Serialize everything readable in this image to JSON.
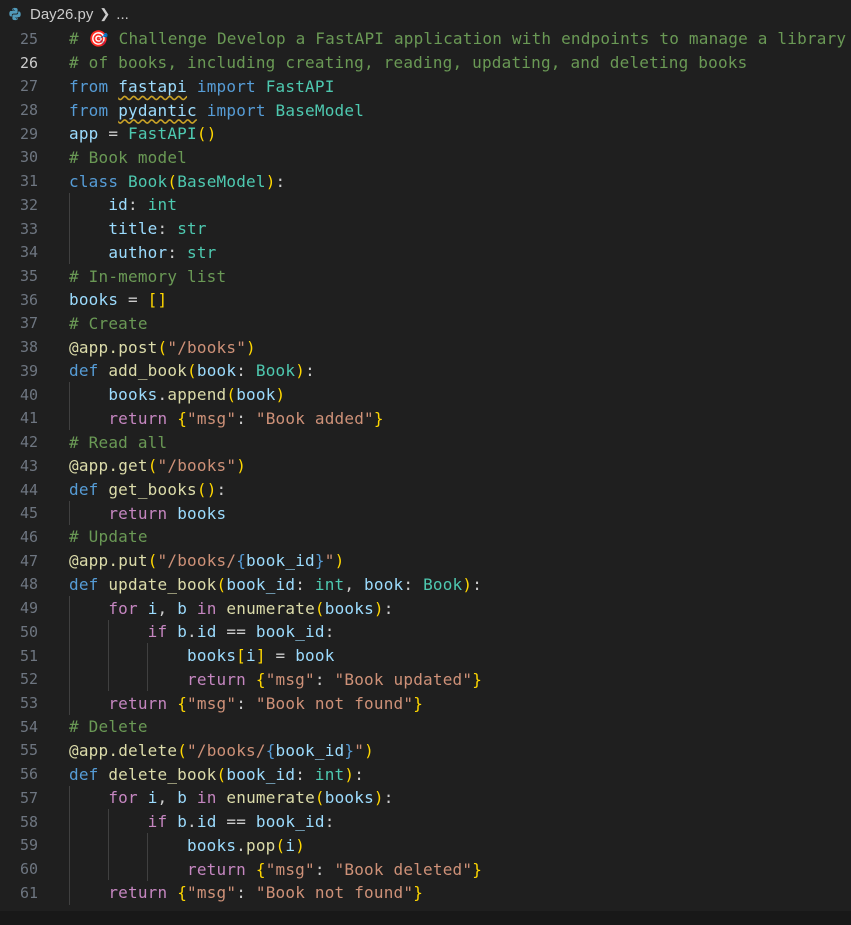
{
  "breadcrumb": {
    "file": "Day26.py",
    "more": "..."
  },
  "editor": {
    "active_line": 26,
    "lines": [
      {
        "n": "25",
        "t": "# 🎯 Challenge Develop a FastAPI application with endpoints to manage a library"
      },
      {
        "n": "26",
        "t": "# of books, including creating, reading, updating, and deleting books"
      },
      {
        "n": "27",
        "t": "from fastapi import FastAPI"
      },
      {
        "n": "28",
        "t": "from pydantic import BaseModel"
      },
      {
        "n": "29",
        "t": "app = FastAPI()"
      },
      {
        "n": "30",
        "t": "# Book model"
      },
      {
        "n": "31",
        "t": "class Book(BaseModel):"
      },
      {
        "n": "32",
        "t": "    id: int"
      },
      {
        "n": "33",
        "t": "    title: str"
      },
      {
        "n": "34",
        "t": "    author: str"
      },
      {
        "n": "35",
        "t": "# In-memory list"
      },
      {
        "n": "36",
        "t": "books = []"
      },
      {
        "n": "37",
        "t": "# Create"
      },
      {
        "n": "38",
        "t": "@app.post(\"/books\")"
      },
      {
        "n": "39",
        "t": "def add_book(book: Book):"
      },
      {
        "n": "40",
        "t": "    books.append(book)"
      },
      {
        "n": "41",
        "t": "    return {\"msg\": \"Book added\"}"
      },
      {
        "n": "42",
        "t": "# Read all"
      },
      {
        "n": "43",
        "t": "@app.get(\"/books\")"
      },
      {
        "n": "44",
        "t": "def get_books():"
      },
      {
        "n": "45",
        "t": "    return books"
      },
      {
        "n": "46",
        "t": "# Update"
      },
      {
        "n": "47",
        "t": "@app.put(\"/books/{book_id}\")"
      },
      {
        "n": "48",
        "t": "def update_book(book_id: int, book: Book):"
      },
      {
        "n": "49",
        "t": "    for i, b in enumerate(books):"
      },
      {
        "n": "50",
        "t": "        if b.id == book_id:"
      },
      {
        "n": "51",
        "t": "            books[i] = book"
      },
      {
        "n": "52",
        "t": "            return {\"msg\": \"Book updated\"}"
      },
      {
        "n": "53",
        "t": "    return {\"msg\": \"Book not found\"}"
      },
      {
        "n": "54",
        "t": "# Delete"
      },
      {
        "n": "55",
        "t": "@app.delete(\"/books/{book_id}\")"
      },
      {
        "n": "56",
        "t": "def delete_book(book_id: int):"
      },
      {
        "n": "57",
        "t": "    for i, b in enumerate(books):"
      },
      {
        "n": "58",
        "t": "        if b.id == book_id:"
      },
      {
        "n": "59",
        "t": "            books.pop(i)"
      },
      {
        "n": "60",
        "t": "            return {\"msg\": \"Book deleted\"}"
      },
      {
        "n": "61",
        "t": "    return {\"msg\": \"Book not found\"}"
      }
    ]
  },
  "colors": {
    "background": "#1f1f1f",
    "keyword": "#569cd6",
    "control": "#c586c0",
    "comment": "#6a9955",
    "string": "#ce9178",
    "function": "#dcdcaa",
    "class": "#4ec9b0",
    "variable": "#9cdcfe",
    "bracket1": "#ffd700",
    "bracket2": "#da70d6",
    "bracket3": "#179fff"
  }
}
